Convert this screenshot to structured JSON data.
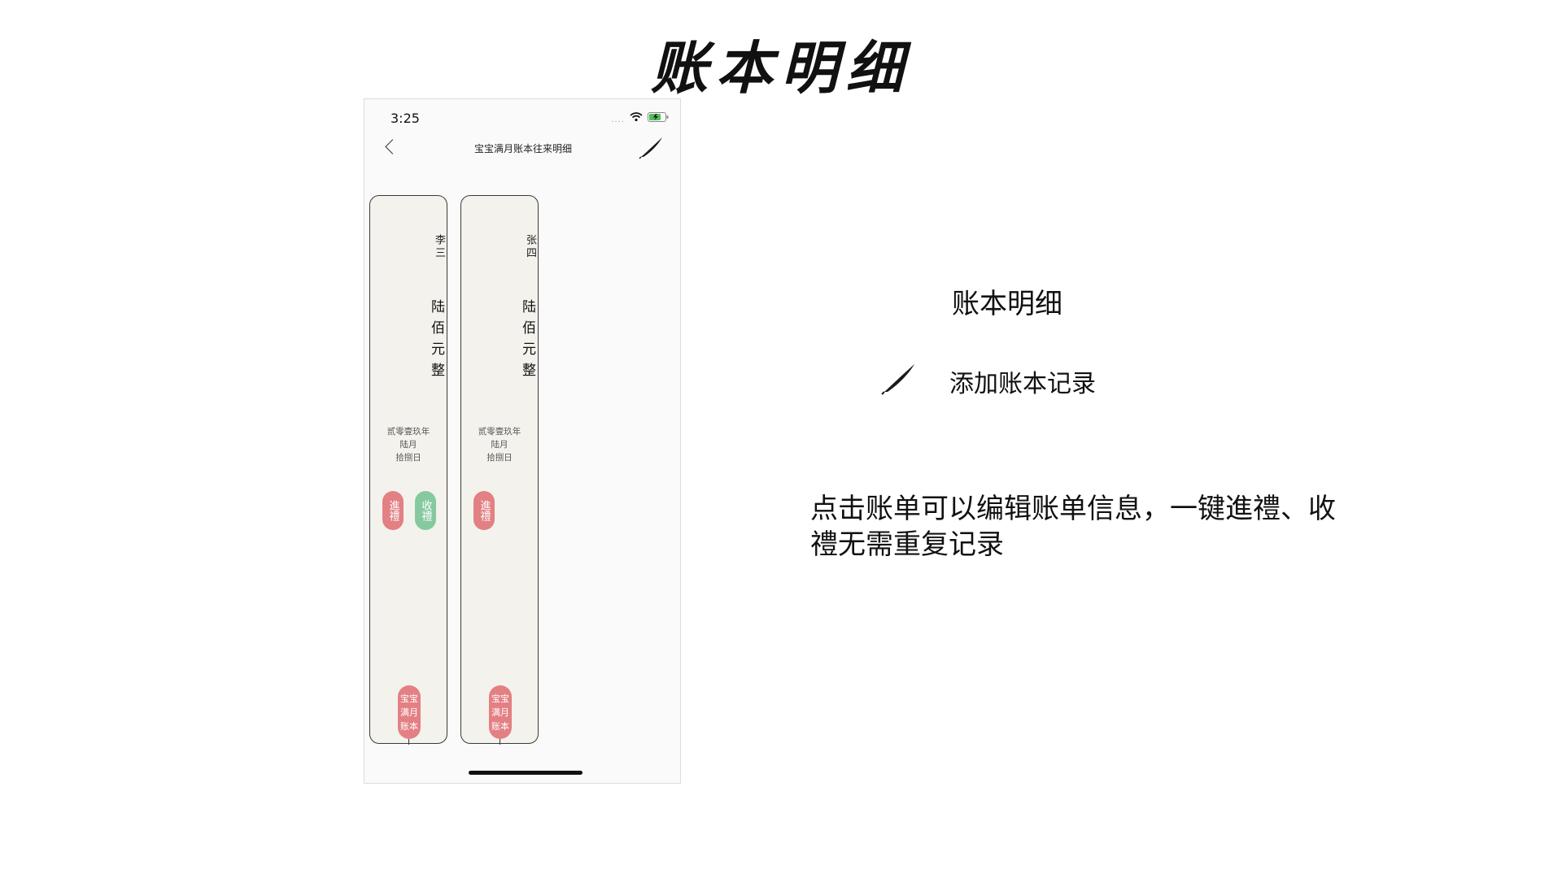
{
  "slide": {
    "title": "账本明细"
  },
  "status_bar": {
    "time": "3:25",
    "signal_dots": "....",
    "wifi_icon": "wifi-icon",
    "battery_icon": "battery-icon"
  },
  "nav": {
    "back_icon": "chevron-left-icon",
    "title": "宝宝满月账本往来明细",
    "add_icon": "brush-icon"
  },
  "cards": [
    {
      "name": "李三",
      "amount": "陆佰元整",
      "date": {
        "year": "贰零壹玖年",
        "month": "陆月",
        "day": "拾捌日"
      },
      "tags": [
        {
          "label": "進禮",
          "color": "#e28084"
        },
        {
          "label": "收禮",
          "color": "#86c9a1"
        }
      ],
      "ledger_tag": [
        "宝宝",
        "满月",
        "账本"
      ]
    },
    {
      "name": "张四",
      "amount": "陆佰元整",
      "date": {
        "year": "贰零壹玖年",
        "month": "陆月",
        "day": "拾捌日"
      },
      "tags": [
        {
          "label": "進禮",
          "color": "#e28084"
        }
      ],
      "ledger_tag": [
        "宝宝",
        "满月",
        "账本"
      ]
    }
  ],
  "legend": {
    "title": "账本明细",
    "add_label": "添加账本记录",
    "add_icon": "brush-icon"
  },
  "description": "点击账单可以编辑账单信息，一键進禮、收禮无需重复记录"
}
